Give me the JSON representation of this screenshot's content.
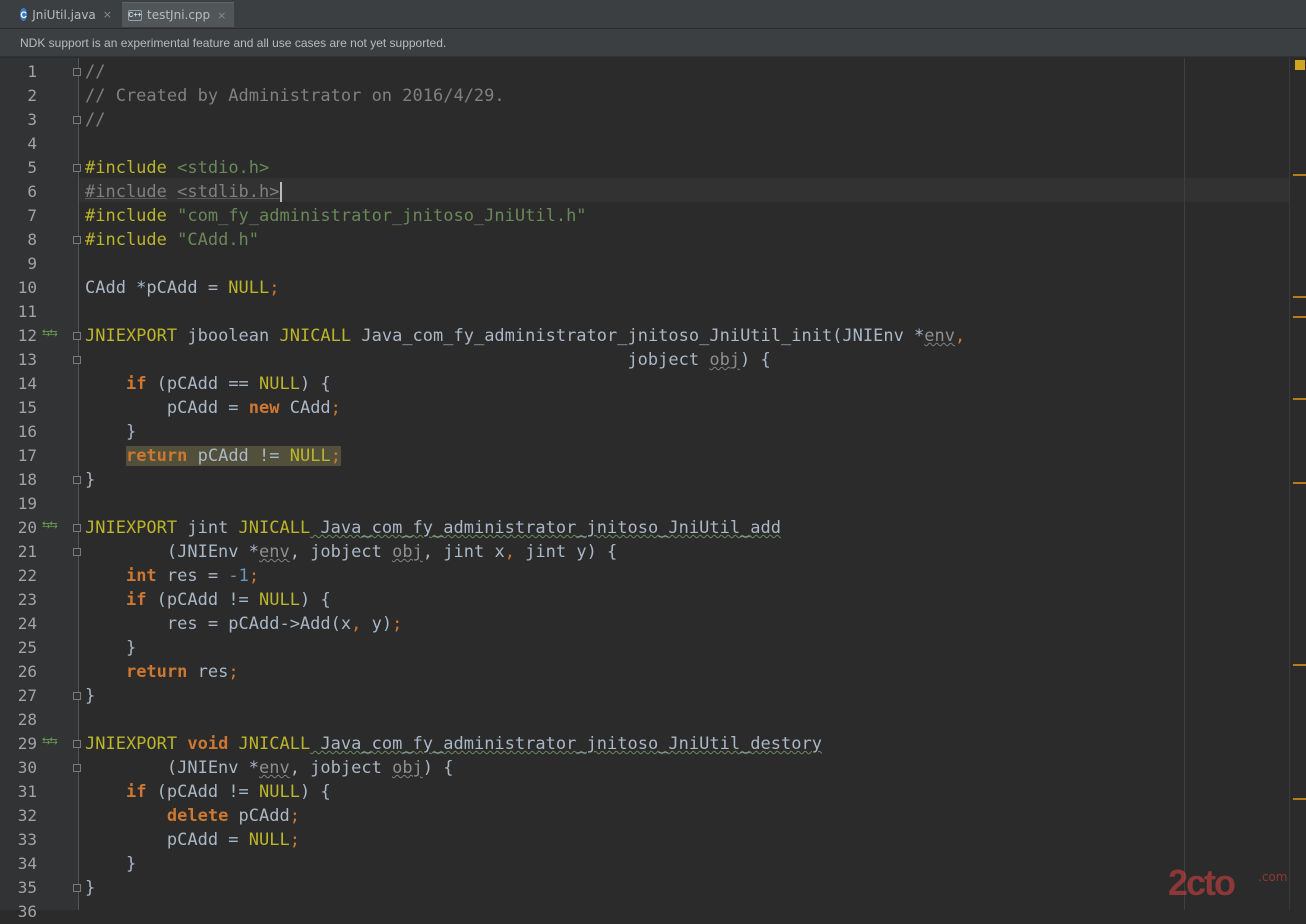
{
  "tabs": [
    {
      "label": "JniUtil.java",
      "icon": "c-class-icon",
      "close": "×"
    },
    {
      "label": "testJni.cpp",
      "icon": "cpp-file-icon",
      "close": "×"
    }
  ],
  "notification": "NDK support is an experimental feature and all use cases are not yet supported.",
  "line_numbers": [
    "1",
    "2",
    "3",
    "4",
    "5",
    "6",
    "7",
    "8",
    "9",
    "10",
    "11",
    "12",
    "13",
    "14",
    "15",
    "16",
    "17",
    "18",
    "19",
    "20",
    "21",
    "22",
    "23",
    "24",
    "25",
    "26",
    "27",
    "28",
    "29",
    "30",
    "31",
    "32",
    "33",
    "34",
    "35",
    "36"
  ],
  "gutter_marker": "⇆⇆",
  "code": {
    "l1_c": "//",
    "l2_c": "// Created by Administrator on 2016/4/29.",
    "l3_c": "//",
    "l5_d": "#include",
    "l5_s": "<stdio.h>",
    "l6_d": "#include",
    "l6_s": "<stdlib.h>",
    "l7_d": "#include",
    "l7_s": "\"com_fy_administrator_jnitoso_JniUtil.h\"",
    "l8_d": "#include",
    "l8_s": "\"CAdd.h\"",
    "l10_a": "CAdd *pCAdd = ",
    "l10_b": "NULL",
    "l10_c": ";",
    "l12_a": "JNIEXPORT",
    "l12_b": " jboolean ",
    "l12_c": "JNICALL",
    "l12_d": " Java_com_fy_administrator_jnitoso_JniUtil_init(JNIEnv *",
    "l12_e": "env",
    "l12_f": ",",
    "l13_a": "                                                     jobject ",
    "l13_b": "obj",
    "l13_c": ") {",
    "l14_a": "    ",
    "l14_b": "if",
    "l14_c": " (pCAdd == ",
    "l14_d": "NULL",
    "l14_e": ") {",
    "l15_a": "        pCAdd = ",
    "l15_b": "new",
    "l15_c": " CAdd",
    "l15_d": ";",
    "l16": "    }",
    "l17_a": "    ",
    "l17_b": "return",
    "l17_c": " pCAdd != ",
    "l17_d": "NULL",
    "l17_e": ";",
    "l18": "}",
    "l20_a": "JNIEXPORT",
    "l20_b": " jint ",
    "l20_c": "JNICALL",
    "l20_d": " Java_com_fy_administrator_jnitoso_JniUtil_add",
    "l21_a": "        (JNIEnv *",
    "l21_b": "env",
    "l21_c": ", jobject ",
    "l21_d": "obj",
    "l21_e": ", jint x",
    "l21_f": ",",
    "l21_g": " jint y) {",
    "l22_a": "    ",
    "l22_b": "int",
    "l22_c": " res = ",
    "l22_d": "-1",
    "l22_e": ";",
    "l23_a": "    ",
    "l23_b": "if",
    "l23_c": " (pCAdd != ",
    "l23_d": "NULL",
    "l23_e": ") {",
    "l24_a": "        res = pCAdd->Add(x",
    "l24_b": ",",
    "l24_c": " y)",
    "l24_d": ";",
    "l25": "    }",
    "l26_a": "    ",
    "l26_b": "return",
    "l26_c": " res",
    "l26_d": ";",
    "l27": "}",
    "l29_a": "JNIEXPORT",
    "l29_b": " void",
    "l29_c": " JNICALL",
    "l29_d": " Java_com_fy_administrator_jnitoso_JniUtil_destory",
    "l30_a": "        (JNIEnv *",
    "l30_b": "env",
    "l30_c": ", jobject ",
    "l30_d": "obj",
    "l30_e": ") {",
    "l31_a": "    ",
    "l31_b": "if",
    "l31_c": " (pCAdd != ",
    "l31_d": "NULL",
    "l31_e": ") {",
    "l32_a": "        ",
    "l32_b": "delete",
    "l32_c": " pCAdd",
    "l32_d": ";",
    "l33_a": "        pCAdd = ",
    "l33_b": "NULL",
    "l33_c": ";",
    "l34": "    }",
    "l35": "}"
  },
  "watermark": {
    "logo": "2cto",
    "sub": ".com"
  },
  "colors": {
    "keyword": "#cc7832",
    "macro": "#bbb529",
    "string": "#6a8759",
    "comment": "#808080",
    "number": "#6897bb",
    "text": "#a9b7c6",
    "background": "#2b2b2b"
  }
}
